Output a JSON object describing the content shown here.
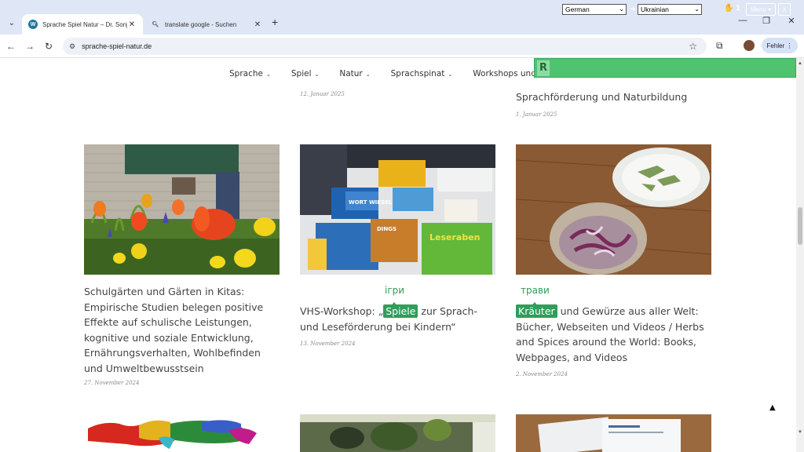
{
  "browser": {
    "tabs": [
      {
        "title": "Sprache Spiel Natur – Dr. Sonja",
        "active": true
      },
      {
        "title": "translate google - Suchen",
        "active": false
      }
    ],
    "new_tab": "+",
    "url": "sprache-spiel-natur.de",
    "profile_button": "Fehler",
    "controls": {
      "minimize": "—",
      "maximize": "❐",
      "close": "✕"
    }
  },
  "translator": {
    "logo": "R",
    "source_lang": "German",
    "target_lang": "Ukrainian",
    "count": "1",
    "menu_label": "Menu ▾",
    "close_label": "X"
  },
  "nav": {
    "items": [
      {
        "label": "Sprache"
      },
      {
        "label": "Spiel"
      },
      {
        "label": "Natur"
      },
      {
        "label": "Sprachspinat"
      },
      {
        "label": "Workshops und Seminare"
      }
    ]
  },
  "previous": {
    "middle_date": "12. Januar 2025",
    "right_title": "Sprachförderung und Naturbildung",
    "right_date": "1. Januar 2025"
  },
  "cards": [
    {
      "title": "Schulgärten und Gärten in Kitas: Empirische Studien belegen positive Effekte auf schulische Leistungen, kognitive und soziale Entwicklung, Ernährungsverhalten, Wohlbefinden und Umweltbewusstsein",
      "date": "27. November 2024"
    },
    {
      "title_before": "VHS-Workshop: „",
      "highlight": "Spiele",
      "title_after": " zur Sprach- und Leseförderung bei Kindern“",
      "translation": "ігри",
      "date": "13. November 2024",
      "box_labels": [
        "WORT WIESEL",
        "Leseraben",
        "DINGS"
      ]
    },
    {
      "highlight": "Kräuter",
      "title_after": " und Gewürze aus aller Welt: Bücher, Webseiten und Videos / Herbs and Spices around the World: Books, Webpages, and Videos",
      "translation": "трави",
      "date": "2. November 2024"
    }
  ],
  "back_to_top": "▲"
}
